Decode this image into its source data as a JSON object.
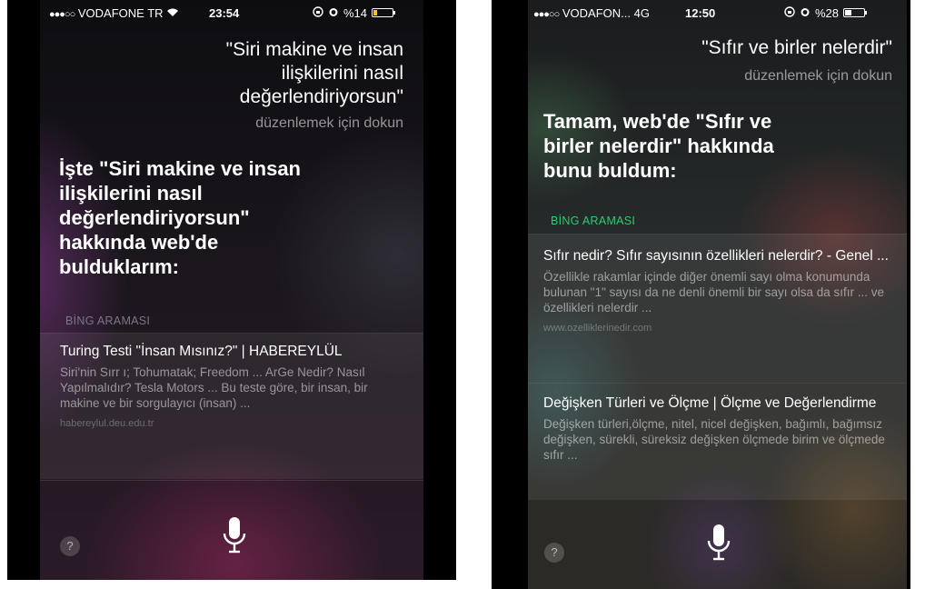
{
  "left": {
    "status": {
      "carrier": "VODAFONE TR",
      "time": "23:54",
      "battery": "%14"
    },
    "query_lines": [
      "\"Siri makine ve insan",
      "ilişkilerini nasıl",
      "değerlendiriyorsun\""
    ],
    "tap_to_edit": "düzenlemek için dokun",
    "answer_lines": [
      "İşte \"Siri makine ve insan",
      "ilişkilerini nasıl",
      "değerlendiriyorsun\"",
      "hakkında web'de",
      "bulduklarım:"
    ],
    "section_label": "BİNG ARAMASI",
    "results": [
      {
        "title": "Turing Testi \"İnsan Mısınız?\" | HABEREYLÜL",
        "snippet": "Siri'nin Sırr ı; Tohumatak; Freedom ... ArGe Nedir? Nasıl Yapılmalıdır? Tesla Motors ... Bu teste göre, bir insan, bir makine ve bir sorgulayıcı (insan) ...",
        "url": "habereylul.deu.edu.tr"
      }
    ],
    "help": "?"
  },
  "right": {
    "status": {
      "carrier": "VODAFON...",
      "network": "4G",
      "time": "12:50",
      "battery": "%28"
    },
    "query_lines": [
      "\"Sıfır ve birler nelerdir\""
    ],
    "tap_to_edit": "düzenlemek için dokun",
    "answer_lines": [
      "Tamam, web'de \"Sıfır ve",
      "birler nelerdir\" hakkında",
      "bunu buldum:"
    ],
    "section_label": "BİNG ARAMASI",
    "results": [
      {
        "title": "Sıfır nedir? Sıfır sayısının özellikleri nelerdir? - Genel ...",
        "snippet": "Özellikle rakamlar içinde diğer önemli sayı olma konumunda bulunan \"1\" sayısı da ne denli önemli bir sayı olsa da sıfır ... ve özellikleri nelerdir ...",
        "url": "www.ozelliklerinedir.com"
      },
      {
        "title": "Değişken Türleri ve Ölçme | Ölçme ve Değerlendirme",
        "snippet": "Değişken türleri,ölçme, nitel, nicel değişken, bağımlı, bağımsız değişken, sürekli, süreksiz değişken ölçmede birim ve ölçmede sıfır ..."
      }
    ],
    "help": "?"
  },
  "colors": {
    "accent_green": "#2ecc71",
    "accent_left_label": "#9a8aa8",
    "bg": "#141418"
  },
  "icons": {
    "mic": "microphone-icon",
    "help": "question-icon",
    "wifi": "wifi-icon",
    "alarm": "alarm-icon",
    "lock": "rotation-lock-icon"
  }
}
